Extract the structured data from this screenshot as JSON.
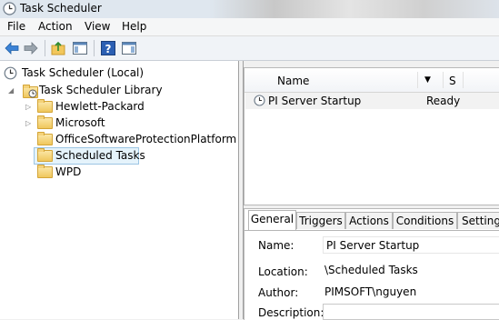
{
  "window": {
    "title": "Task Scheduler"
  },
  "menu": {
    "file": "File",
    "action": "Action",
    "view": "View",
    "help": "Help"
  },
  "toolbar": {
    "back": "arrow-left-icon",
    "forward": "arrow-right-icon",
    "up": "folder-up-icon",
    "show_hide_tree": "console-tree-icon",
    "help": "help-icon",
    "show_hide_action_pane": "action-pane-icon"
  },
  "tree": {
    "root": "Task Scheduler (Local)",
    "library": "Task Scheduler Library",
    "items": [
      "Hewlett-Packard",
      "Microsoft",
      "OfficeSoftwareProtectionPlatform",
      "Scheduled Tasks",
      "WPD"
    ],
    "selected": "Scheduled Tasks"
  },
  "tasklist": {
    "columns": {
      "name": "Name",
      "status": "S"
    },
    "rows": [
      {
        "name": "PI Server Startup",
        "status": "Ready"
      }
    ]
  },
  "details": {
    "tabs": [
      "General",
      "Triggers",
      "Actions",
      "Conditions",
      "Settings"
    ],
    "active_tab": "General",
    "fields": {
      "name_label": "Name:",
      "name_value": "PI Server Startup",
      "location_label": "Location:",
      "location_value": "\\Scheduled Tasks",
      "author_label": "Author:",
      "author_value": "PIMSOFT\\nguyen",
      "description_label": "Description:",
      "description_value": ""
    }
  }
}
